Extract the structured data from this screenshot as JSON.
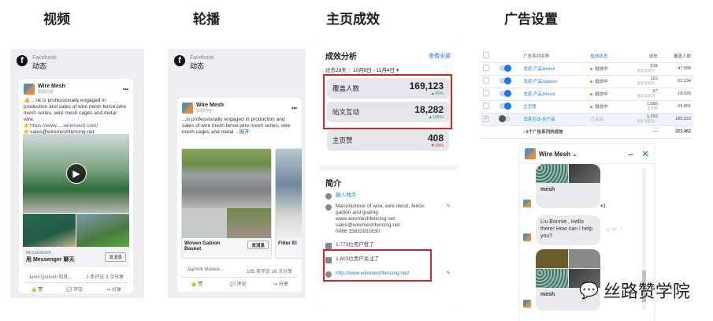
{
  "sections": [
    "视频",
    "轮播",
    "主页成效",
    "广告设置"
  ],
  "facebook": {
    "brand": "Facebook",
    "feed_label": "动态"
  },
  "video_post": {
    "page_name": "Wire Mesh",
    "sponsored": "赞助内容 · ",
    "text": "👍 ...nk is professionally engaged in production and sales of wire mesh fence,wire mesh series, wire mesh cages and metal wire.",
    "link": "👉https://www.....wiremesh.com/",
    "email": "👉sales@wiremeshfencing.net",
    "messenger_label": "MESSENGER",
    "messenger_cta": "用 Messenger 聊天",
    "send_button": "发消息",
    "reactions": "Jamil Qureshi 和其...",
    "comments": "2 条评论",
    "shares": "3 次分享",
    "like": "赞",
    "comment": "评论",
    "share": "分享"
  },
  "carousel_post": {
    "page_name": "Wire Mesh",
    "sponsored": "赞助内容 · ",
    "text": "...is professionally engaged in production and sales of wire mesh fence,wire mesh series, wire mesh cages and metal",
    "more": "...展开",
    "card1_title": "Woven Gabion Basket",
    "card2_title": "Filter El",
    "send_button": "发消息",
    "reactions": "Jaymoh Maxwe...",
    "comments": "195 条评论",
    "shares": "16 次分享",
    "like": "赞",
    "comment": "评论",
    "share": "分享"
  },
  "insights": {
    "title": "成效分析",
    "see_all": "查看全部",
    "range": "过去28天 ：10月8日 - 11月4日 ▾",
    "metrics": [
      {
        "label": "覆盖人数",
        "value": "169,123",
        "change": "▲45%",
        "dir": "up"
      },
      {
        "label": "帖文互动",
        "value": "18,282",
        "change": "▲105%",
        "dir": "up"
      },
      {
        "label": "主页赞",
        "value": "408",
        "change": "▼35%",
        "dir": "down"
      }
    ]
  },
  "about": {
    "title": "简介",
    "location": "输入地点",
    "description": [
      "Manufacturer of wire, wire mesh, fence,",
      "gabion and grating.",
      "www.wiremeshfencing.net",
      "sales@wiremeshfencing.net",
      "0086 15832831630"
    ],
    "likes": "1,773位用户赞了",
    "follows": "1,803位用户关注了",
    "website": "http://www.wiremeshfencing.net/"
  },
  "ads_table": {
    "headers": [
      "广告系列名称",
      "投放状态",
      "成效",
      "覆盖人数"
    ],
    "rows": [
      {
        "name": "消息-产品3mesh",
        "status": "投放中",
        "results": "218",
        "sub": "发起消息对...",
        "reach": "47,998",
        "on": true,
        "checked": false
      },
      {
        "name": "消息-产品2gabion",
        "status": "投放中",
        "results": "122",
        "sub": "发起消息对...",
        "reach": "52,134",
        "on": true,
        "checked": false
      },
      {
        "name": "消息-产品1fence",
        "status": "投放中",
        "results": "57",
        "sub": "发起消息对...",
        "reach": "18,026",
        "on": true,
        "checked": false
      },
      {
        "name": "主页赞",
        "status": "投放中",
        "results": "1,580",
        "sub": "主页赞",
        "reach": "23,851",
        "on": true,
        "checked": false
      },
      {
        "name": "消息互动-全产品",
        "status": "已关闭",
        "results": "1,293",
        "sub": "发起消息对...",
        "reach": "185,223",
        "on": false,
        "checked": true
      }
    ],
    "footer_label": "5个广告系列的成效",
    "footer_results": "—",
    "footer_reach": "322,462"
  },
  "chat": {
    "name": "Wire Mesh ⌄",
    "caption1": "mesh",
    "reaction_count": "1",
    "message": "Liu Bonnie , Hello there! How can I help you?",
    "caption2": "mesh"
  },
  "watermark": "丝路赞学院"
}
